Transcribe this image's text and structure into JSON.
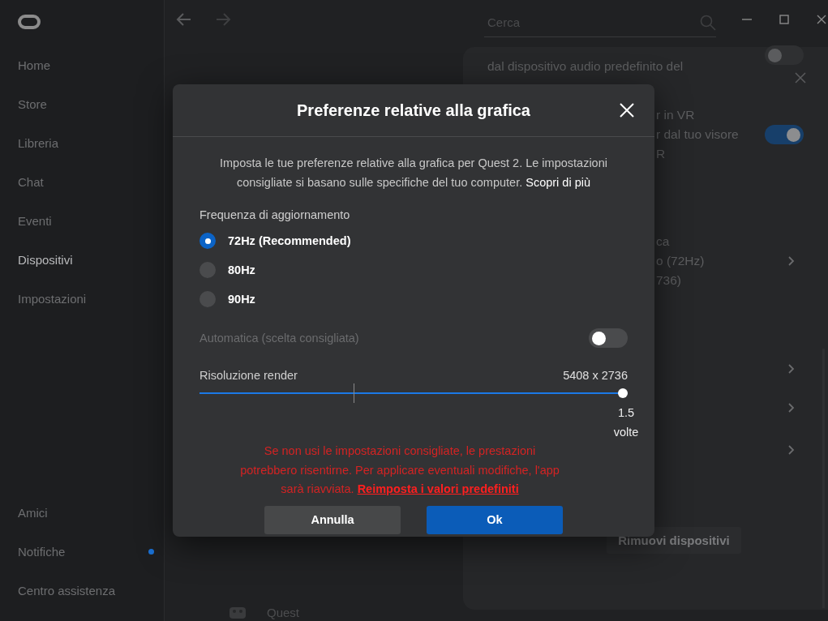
{
  "sidebar": {
    "items": [
      {
        "label": "Home",
        "selected": false
      },
      {
        "label": "Store",
        "selected": false
      },
      {
        "label": "Libreria",
        "selected": false
      },
      {
        "label": "Chat",
        "selected": false
      },
      {
        "label": "Eventi",
        "selected": false
      },
      {
        "label": "Dispositivi",
        "selected": true
      },
      {
        "label": "Impostazioni",
        "selected": false
      }
    ],
    "bottom_items": [
      {
        "label": "Amici",
        "badge": false
      },
      {
        "label": "Notifiche",
        "badge": true
      },
      {
        "label": "Centro assistenza",
        "badge": false
      }
    ]
  },
  "search": {
    "placeholder": "Cerca"
  },
  "background_panel": {
    "audio_text": "dal dispositivo audio predefinito del",
    "audio_toggle_on": false,
    "vr_lines": [
      "r in VR",
      "r dal tuo visore",
      "R"
    ],
    "vr_toggle_on": true,
    "graphics_lines": [
      "ca",
      "o (72Hz)",
      "736)"
    ],
    "remove_button": "Rimuovi dispositivi"
  },
  "device_item": {
    "label": "Quest"
  },
  "dialog": {
    "title": "Preferenze relative alla grafica",
    "description": "Imposta le tue preferenze relative alla grafica per Quest 2. Le impostazioni consigliate si basano sulle specifiche del tuo computer.",
    "description_link": "Scopri di più",
    "refresh_label": "Frequenza di aggiornamento",
    "refresh_options": [
      {
        "label": "72Hz (Recommended)",
        "selected": true
      },
      {
        "label": "80Hz",
        "selected": false
      },
      {
        "label": "90Hz",
        "selected": false
      }
    ],
    "auto": {
      "label": "Automatica (scelta consigliata)",
      "on": false,
      "disabled": true
    },
    "resolution": {
      "label": "Risoluzione render",
      "value": "5408 x 2736",
      "level": 1,
      "multiplier": "1.5 volte"
    },
    "warning": "Se non usi le impostazioni consigliate, le prestazioni potrebbero risentirne. Per applicare eventuali modifiche, l'app sarà riavviata.",
    "warning_link": "Reimposta i valori predefiniti",
    "buttons": [
      {
        "label": "Annulla",
        "kind": "secondary"
      },
      {
        "label": "Ok",
        "kind": "primary"
      }
    ]
  }
}
